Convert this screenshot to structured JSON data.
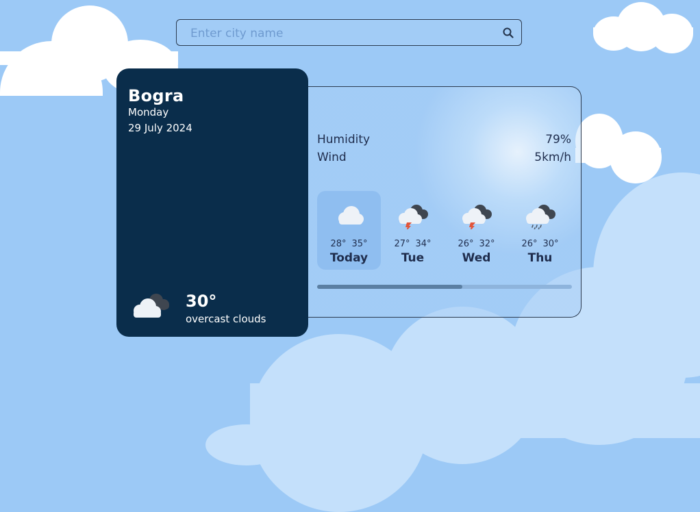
{
  "search": {
    "placeholder": "Enter city name",
    "value": ""
  },
  "current": {
    "city": "Bogra",
    "day": "Monday",
    "date": "29 July 2024",
    "temp": "30°",
    "description": "overcast clouds",
    "icon": "overcast-cloud-icon"
  },
  "details": {
    "humidity_label": "Humidity",
    "humidity_value": "79%",
    "wind_label": "Wind",
    "wind_value": "5km/h"
  },
  "forecast": [
    {
      "day": "Today",
      "low": "28°",
      "high": "35°",
      "icon": "cloud-icon"
    },
    {
      "day": "Tue",
      "low": "27°",
      "high": "34°",
      "icon": "thunderstorm-icon"
    },
    {
      "day": "Wed",
      "low": "26°",
      "high": "32°",
      "icon": "thunderstorm-icon"
    },
    {
      "day": "Thu",
      "low": "26°",
      "high": "30°",
      "icon": "rain-icon"
    }
  ],
  "forecast_scroll_fraction": 0.57,
  "colors": {
    "background": "#9cc9f6",
    "card_dark": "#0a2d4b",
    "active_day": "#8fbef0",
    "text_dark": "#1f2d4d"
  }
}
